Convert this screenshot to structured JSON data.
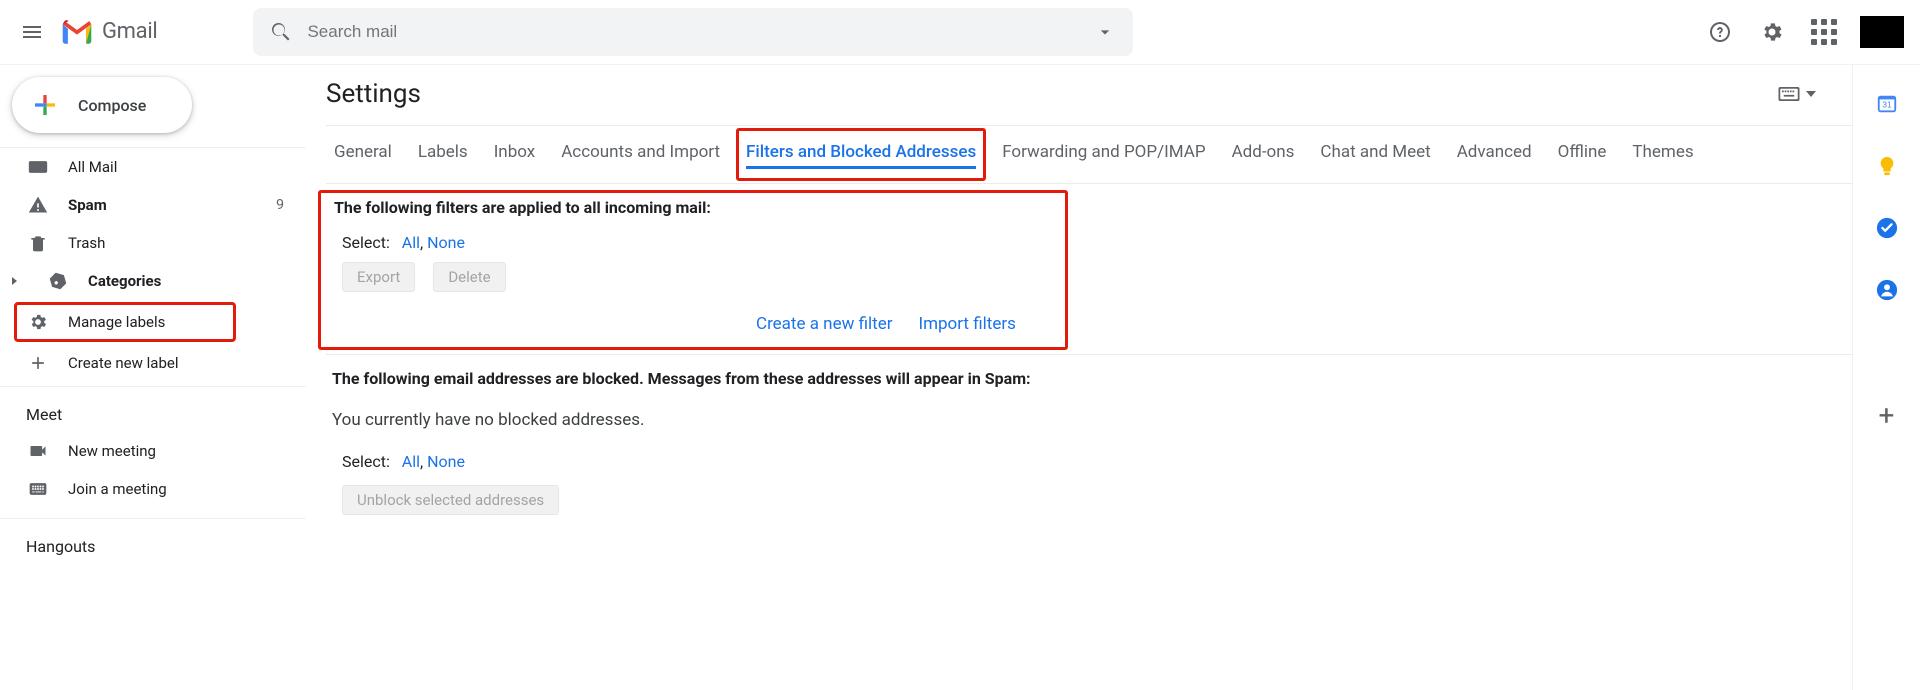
{
  "header": {
    "app_name": "Gmail",
    "search_placeholder": "Search mail"
  },
  "sidebar": {
    "compose_label": "Compose",
    "items": [
      {
        "icon": "allmail",
        "label": "All Mail",
        "bold": false
      },
      {
        "icon": "spam",
        "label": "Spam",
        "bold": true,
        "count": "9"
      },
      {
        "icon": "trash",
        "label": "Trash",
        "bold": false
      },
      {
        "icon": "cat",
        "label": "Categories",
        "bold": true,
        "caret": true
      },
      {
        "icon": "gear",
        "label": "Manage labels",
        "bold": false,
        "highlight": true
      },
      {
        "icon": "plus",
        "label": "Create new label",
        "bold": false
      }
    ],
    "meet_title": "Meet",
    "meet_new": "New meeting",
    "meet_join": "Join a meeting",
    "hangouts_title": "Hangouts"
  },
  "settings": {
    "title": "Settings",
    "tabs": [
      "General",
      "Labels",
      "Inbox",
      "Accounts and Import",
      "Filters and Blocked Addresses",
      "Forwarding and POP/IMAP",
      "Add-ons",
      "Chat and Meet",
      "Advanced",
      "Offline",
      "Themes"
    ],
    "active_tab_index": 4,
    "filters_header": "The following filters are applied to all incoming mail:",
    "select_label": "Select:",
    "select_all": "All",
    "select_none": "None",
    "export_btn": "Export",
    "delete_btn": "Delete",
    "create_filter": "Create a new filter",
    "import_filters": "Import filters",
    "blocked_header": "The following email addresses are blocked. Messages from these addresses will appear in Spam:",
    "blocked_empty": "You currently have no blocked addresses.",
    "unblock_btn": "Unblock selected addresses"
  }
}
